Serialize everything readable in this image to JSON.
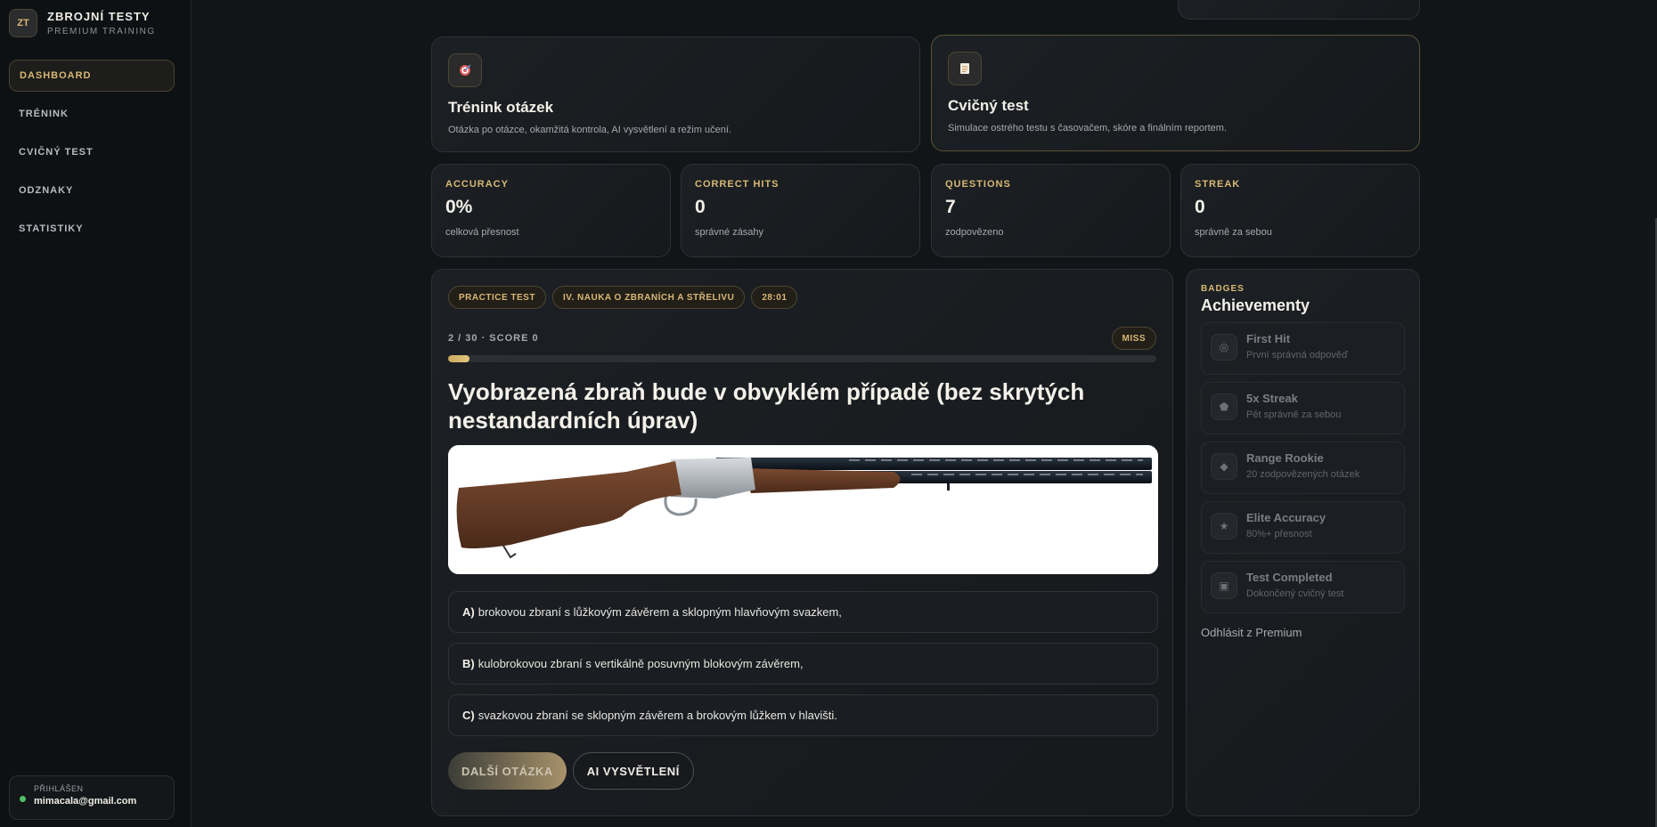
{
  "brand": {
    "logo": "ZT",
    "title": "ZBROJNÍ TESTY",
    "subtitle": "PREMIUM TRAINING"
  },
  "nav": [
    {
      "label": "DASHBOARD",
      "active": true
    },
    {
      "label": "TRÉNINK",
      "active": false
    },
    {
      "label": "CVIČNÝ TEST",
      "active": false
    },
    {
      "label": "ODZNAKY",
      "active": false
    },
    {
      "label": "STATISTIKY",
      "active": false
    }
  ],
  "user": {
    "label": "PŘIHLÁŠEN",
    "email": "mimacala@gmail.com"
  },
  "modes": [
    {
      "icon": "target-icon",
      "title": "Trénink otázek",
      "desc": "Otázka po otázce, okamžitá kontrola, AI vysvětlení a režim učení."
    },
    {
      "icon": "document-icon",
      "title": "Cvičný test",
      "desc": "Simulace ostrého testu s časovačem, skóre a finálním reportem."
    }
  ],
  "stats": [
    {
      "label": "ACCURACY",
      "value": "0%",
      "sub": "celková přesnost"
    },
    {
      "label": "CORRECT HITS",
      "value": "0",
      "sub": "správné zásahy"
    },
    {
      "label": "QUESTIONS",
      "value": "7",
      "sub": "zodpovězeno"
    },
    {
      "label": "STREAK",
      "value": "0",
      "sub": "správně za sebou"
    }
  ],
  "quiz": {
    "pills": [
      "PRACTICE TEST",
      "IV. NAUKA O ZBRANÍCH A STŘELIVU",
      "28:01"
    ],
    "progress_text": "2 / 30 · SCORE 0",
    "status": "MISS",
    "progress_fraction": 0.03,
    "question": "Vyobrazená zbraň bude v obvyklém případě (bez skrytých nestandardních úprav)",
    "answers": [
      {
        "key": "A)",
        "text": "brokovou zbraní s lůžkovým závěrem a sklopným hlavňovým svazkem,"
      },
      {
        "key": "B)",
        "text": "kulobrokovou zbraní s vertikálně posuvným blokovým závěrem,"
      },
      {
        "key": "C)",
        "text": "svazkovou zbraní se sklopným závěrem a brokovým lůžkem v hlavišti."
      }
    ],
    "next_label": "DALŠÍ OTÁZKA",
    "ai_label": "AI VYSVĚTLENÍ"
  },
  "badges": {
    "label": "BADGES",
    "title": "Achievementy",
    "items": [
      {
        "icon": "target-icon",
        "name": "First Hit",
        "desc": "První správná odpověď"
      },
      {
        "icon": "pentagon-icon",
        "name": "5x Streak",
        "desc": "Pět správně za sebou"
      },
      {
        "icon": "diamond-icon",
        "name": "Range Rookie",
        "desc": "20 zodpovězených otázek"
      },
      {
        "icon": "star-icon",
        "name": "Elite Accuracy",
        "desc": "80%+ přesnost"
      },
      {
        "icon": "square-icon",
        "name": "Test Completed",
        "desc": "Dokončený cvičný test"
      }
    ],
    "logout": "Odhlásit z Premium"
  }
}
